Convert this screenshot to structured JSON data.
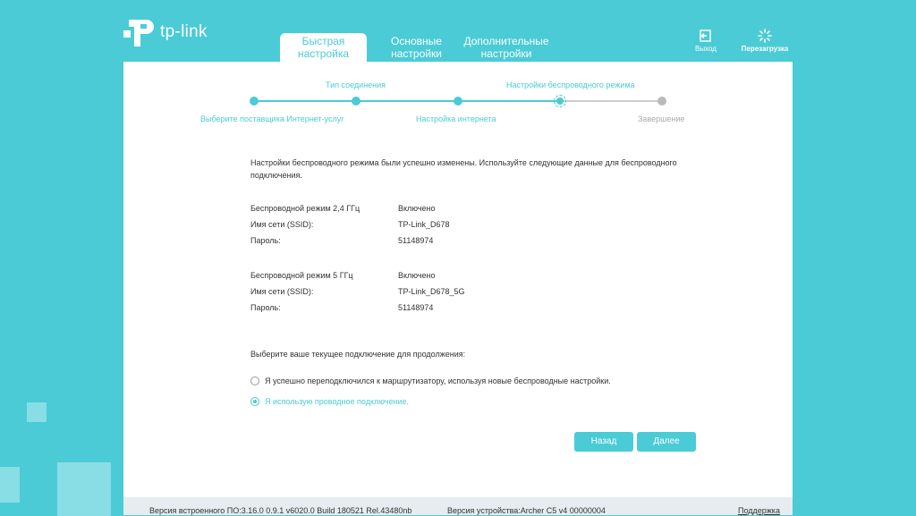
{
  "brand": {
    "name": "tp-link"
  },
  "nav": {
    "tabs": [
      {
        "label": "Быстрая настройка",
        "line1": "Быстрая",
        "line2": "настройка"
      },
      {
        "label": "Основные настройки",
        "line1": "Основные",
        "line2": "настройки"
      },
      {
        "label": "Дополнительные настройки",
        "line1": "Дополнительные",
        "line2": "настройки"
      }
    ],
    "logout": "Выход",
    "reboot": "Перезагрузка"
  },
  "steps": {
    "top": [
      "Тип соединения",
      "Настройки беспроводного режима"
    ],
    "bottom": [
      "Выберите поставщика Интернет-услуг",
      "Настройка интернета",
      "Завершение"
    ]
  },
  "content": {
    "intro_line1": "Настройки беспроводного режима были успешно изменены. Используйте следующие данные для беспроводного",
    "intro_line2": "подключения.",
    "band24": {
      "label": "Беспроводной режим 2,4 ГГц",
      "value": "Включено"
    },
    "ssid24": {
      "label": "Имя сети (SSID):",
      "value": "TP-Link_D678"
    },
    "pass24": {
      "label": "Пароль:",
      "value": "51148974"
    },
    "band5": {
      "label": "Беспроводной режим 5 ГГц",
      "value": "Включено"
    },
    "ssid5": {
      "label": "Имя сети (SSID):",
      "value": "TP-Link_D678_5G"
    },
    "pass5": {
      "label": "Пароль:",
      "value": "51148974"
    },
    "choose": "Выберите ваше текущее подключение для продолжения:",
    "option_wireless": "Я успешно переподключился к маршрутизатору, используя новые беспроводные настройки.",
    "option_wired": "Я использую проводное подключение."
  },
  "buttons": {
    "back": "Назад",
    "next": "Далее"
  },
  "footer": {
    "firmware": "Версия встроенного ПО:3.16.0 0.9.1 v6020.0 Build 180521 Rel.43480nb",
    "hardware": "Версия устройства:Archer C5 v4 00000004",
    "support": "Поддержка"
  },
  "colors": {
    "accent": "#4acbd6",
    "background": "#4acbd6",
    "inactive": "#cccccc"
  }
}
